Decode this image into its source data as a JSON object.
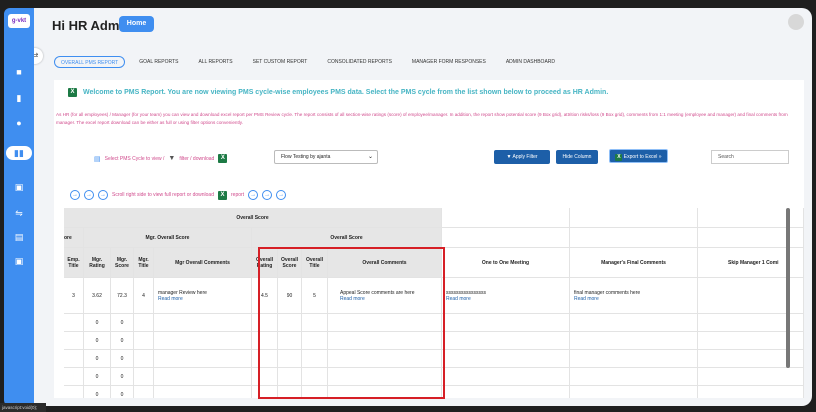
{
  "sidebar": {
    "logo": "g-vkt",
    "icons": [
      "toggle-icon",
      "dashboard-icon",
      "reports-icon",
      "team-icon",
      "pms-icon",
      "calendar-icon",
      "goals-icon",
      "forms-icon",
      "settings-icon"
    ]
  },
  "header": {
    "title": "Hi HR Admin",
    "home_label": "Home"
  },
  "tabs": [
    {
      "label": "OVERALL PMS REPORT",
      "active": true
    },
    {
      "label": "GOAL REPORTS"
    },
    {
      "label": "ALL REPORTS"
    },
    {
      "label": "SET CUSTOM REPORT"
    },
    {
      "label": "CONSOLIDATED REPORTS"
    },
    {
      "label": "MANAGER FORM RESPONSES"
    },
    {
      "label": "ADMIN DASHBOARD"
    }
  ],
  "welcome": {
    "title": "Welcome to PMS Report. You are now viewing PMS cycle-wise employees PMS data. Select the PMS cycle from the list shown below to proceed as HR Admin.",
    "description": "As HR (for all employees) / Manager (for your team) you can view and download excel report per PMS Review cycle. The report consists of all section-wise ratings (score) of employee/manager. In addition, the report show potential score (9 Box grid), attrition risks/loss (9 Box grid), comments from 1:1 meeting (employee and manager) and final comments from manager. The excel report download can be either as full or using filter options conveniently."
  },
  "controls": {
    "select_text": "Select PMS Cycle to view /",
    "filter_text": "filter / download",
    "cycle_value": "Flow Testing by ajanta",
    "apply_label": "Apply Filter",
    "hide_label": "Hide Column",
    "export_label": "Export to Excel »",
    "search_placeholder": "Search"
  },
  "scroll_hint": {
    "text": "Scroll right side to view full report or download",
    "report": "report"
  },
  "table": {
    "overall_score": "Overall Score",
    "mgr_overall_score": "Mgr. Overall Score",
    "overall_score_sub": "Overall Score",
    "partial_left": "ore",
    "headers": {
      "emp_title": "Emp. Title",
      "mgr_rating": "Mgr. Rating",
      "mgr_score": "Mgr. Score",
      "mgr_title": "Mgr. Title",
      "mgr_comments": "Mgr Overall Comments",
      "overall_rating": "Overall Rating",
      "overall_score": "Overall Score",
      "overall_title": "Overall Title",
      "overall_comments": "Overall Comments",
      "one_to_one": "One to One Meeting",
      "manager_final": "Manager's Final Comments",
      "skip_manager": "Skip Manager 1 Comi"
    },
    "first_row": {
      "emp_title": "3",
      "mgr_rating": "3.62",
      "mgr_score": "72.3",
      "mgr_title": "4",
      "mgr_comments": "manager Review here",
      "read_more": "Read more",
      "overall_rating": "4.5",
      "overall_score": "90",
      "overall_title": "5",
      "overall_comments": "Appeal Score comments are here",
      "one_to_one": "ssssssssssssssss",
      "manager_final": "final manager comments here"
    },
    "zero_rows": [
      [
        "0",
        "0"
      ],
      [
        "0",
        "0"
      ],
      [
        "0",
        "0"
      ],
      [
        "0",
        "0"
      ],
      [
        "0",
        "0"
      ]
    ]
  },
  "status_bar": "javascript:void(0);"
}
